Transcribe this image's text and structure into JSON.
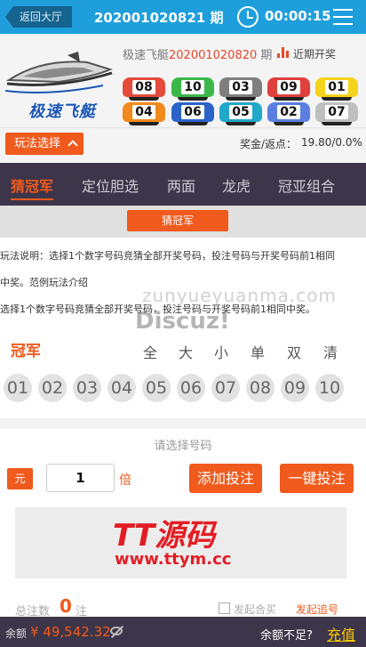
{
  "header": {
    "back_label": "返回大厅",
    "issue": "202001020821 期",
    "countdown": "00:00:15",
    "clock_icon": "clock-icon",
    "menu_icon": "menu-icon"
  },
  "last_draw": {
    "logo_text": "极速飞艇",
    "game_name": "极速飞艇",
    "issue_number": "202001020820",
    "issue_suffix": "期",
    "trend_label": "近期开奖",
    "numbers": [
      "08",
      "10",
      "03",
      "09",
      "01",
      "04",
      "06",
      "05",
      "02",
      "07"
    ],
    "colors": [
      "#e34b3a",
      "#3cb84a",
      "#7f7f7f",
      "#e0403b",
      "#f6d31b",
      "#f08a1c",
      "#2b63c9",
      "#22a8c8",
      "#5a7fe0",
      "#bfbfbf"
    ]
  },
  "play": {
    "select_label": "玩法选择",
    "rebate_label": "奖金/返点：",
    "rebate_value": "19.80/0.0%"
  },
  "tabs": [
    "猜冠军",
    "定位胆选",
    "两面",
    "龙虎",
    "冠亚组合"
  ],
  "subtab": "猜冠军",
  "description": {
    "line1": "玩法说明：选择1个数字号码竞猜全部开奖号码，投注号码与开奖号码前1相同",
    "line2": "中奖。范例玩法介绍",
    "line3": "选择1个数字号码竞猜全部开奖号码，投注号码与开奖号码前1相同中奖。"
  },
  "watermark": {
    "site": "zunyueyuanma.com",
    "brand": "Discuz!"
  },
  "board": {
    "position_label": "冠军",
    "quick_picks": [
      "全",
      "大",
      "小",
      "单",
      "双",
      "清"
    ],
    "balls": [
      "01",
      "02",
      "03",
      "04",
      "05",
      "06",
      "07",
      "08",
      "09",
      "10"
    ],
    "hint": "请选择号码"
  },
  "bet": {
    "unit_label": "元",
    "multiplier": "1",
    "multiplier_unit": "倍",
    "add_label": "添加投注",
    "quick_label": "一键投注"
  },
  "bet_list": {
    "ad_brand": "TT源码",
    "ad_url": "www.ttym.cc"
  },
  "totals": {
    "count_label": "总注数",
    "count": "0",
    "count_unit": "注",
    "joint_label": "发起合买",
    "chase_label": "发起追号"
  },
  "footer": {
    "balance_label": "余额",
    "balance": "¥ 49,542.32",
    "insufficient_label": "余额不足?",
    "recharge_label": "充值"
  },
  "colors": {
    "accent": "#f05a1c",
    "header_bg": "#1e9fdc",
    "tab_bg": "#3d3549",
    "recharge": "#ffcc00"
  }
}
